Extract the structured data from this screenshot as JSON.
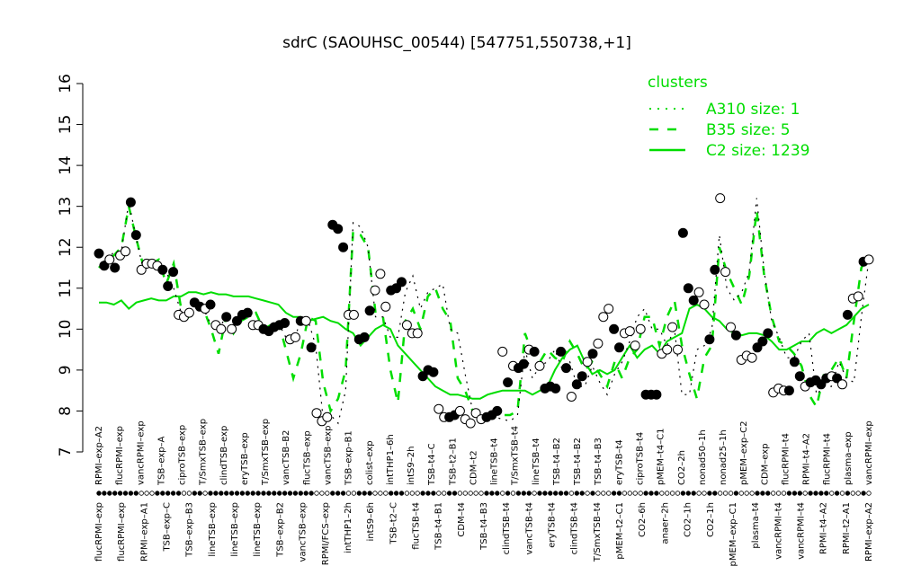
{
  "chart_data": {
    "type": "line",
    "title": "sdrC (SAOUHSC_00544) [547751,550738,+1]",
    "xlabel": "",
    "ylabel": "",
    "ylim": [
      7,
      16
    ],
    "yticks": [
      7,
      8,
      9,
      10,
      11,
      12,
      13,
      14,
      15,
      16
    ],
    "grid": false,
    "legend": {
      "title": "clusters",
      "placement": "top-right",
      "color": "#00dd00",
      "entries": [
        {
          "label": "A310 size: 1",
          "style": "dotted"
        },
        {
          "label": "B35 size: 5",
          "style": "dashed"
        },
        {
          "label": "C2 size: 1239",
          "style": "solid"
        }
      ]
    },
    "tick_labels_top": [
      "RPMI–exp–A2",
      "flucRPMI–exp",
      "vancRPMI–exp",
      "TSB–exp–A",
      "ciproTSB–exp",
      "T/SmxTSB–exp",
      "clindTSB–exp",
      "eryTSB–exp",
      "T/SmxTSB–exp",
      "vancTSB–B2",
      "flucTSB–exp",
      "vancTSB–exp",
      "TSB–exp–B1",
      "colist–exp",
      "intTHP1–6h",
      "intS9–2h",
      "TSB–t4–C",
      "TSB–t2–B1",
      "CDM–t2",
      "lineTSB–t4",
      "T/SmxTSB–t4",
      "lineTSB–t4",
      "TSB–t4–B2",
      "TSB–t4–B2",
      "TSB–t4–B3",
      "eryTSB–t4",
      "ciproTSB–t4",
      "pMEM–t4–C1",
      "CO2–2h",
      "nonad50–1h",
      "nonad25–1h",
      "pMEM–exp–C2",
      "CDM–exp",
      "flucRPMI–t4",
      "RPMI–t4–A2",
      "flucRPMI–t4",
      "plasma–exp",
      "vancRPMI–exp"
    ],
    "tick_labels_bottom": [
      "flucRPMI–exp",
      "flucRPMI–exp",
      "RPMI–exp–A1",
      "TSB–exp–C",
      "TSB–exp–B3",
      "lineTSB–exp",
      "lineTSB–exp",
      "lineTSB–exp",
      "TSB–exp–B2",
      "vancTSB–exp",
      "RPMI/FCS–exp",
      "intTHP1–2h",
      "intS9–6h",
      "TSB–t2–C",
      "flucTSB–t4",
      "TSB–t4–B1",
      "CDM–t4",
      "TSB–t4–B3",
      "clindTSB–t4",
      "vancTSB–t4",
      "eryTSB–t4",
      "clindTSB–t4",
      "T/SmxTSB–t4",
      "pMEM–t2–C1",
      "CO2–6h",
      "anaer–2h",
      "CO2–1h",
      "CO2–1h",
      "pMEM–exp–C1",
      "plasma–t4",
      "vancRPMI–t4",
      "vancRPMI–t4",
      "RPMI–t4–A2",
      "RPMI–t2–A1",
      "RPMI–exp–A2"
    ],
    "series": [
      {
        "style": "solid",
        "color": "#00dd00",
        "y": [
          10.65,
          10.65,
          10.6,
          10.7,
          10.5,
          10.65,
          10.7,
          10.75,
          10.7,
          10.7,
          10.8,
          10.8,
          10.9,
          10.9,
          10.85,
          10.9,
          10.85,
          10.85,
          10.8,
          10.8,
          10.8,
          10.75,
          10.7,
          10.65,
          10.6,
          10.4,
          10.3,
          10.3,
          10.2,
          10.25,
          10.3,
          10.2,
          10.15,
          10.0,
          9.9,
          9.6,
          9.8,
          10.0,
          10.1,
          10.0,
          9.6,
          9.4,
          9.2,
          9.0,
          8.8,
          8.6,
          8.5,
          8.4,
          8.4,
          8.35,
          8.3,
          8.3,
          8.4,
          8.45,
          8.5,
          8.5,
          8.5,
          8.5,
          8.4,
          8.5,
          8.6,
          9.0,
          9.3,
          9.5,
          9.6,
          9.2,
          8.9,
          9.0,
          8.9,
          9.0,
          9.3,
          9.6,
          9.3,
          9.5,
          9.6,
          9.4,
          9.7,
          9.8,
          9.9,
          10.5,
          10.6,
          10.5,
          10.3,
          10.2,
          10.0,
          9.9,
          9.85,
          9.9,
          9.9,
          9.85,
          9.7,
          9.5,
          9.5,
          9.6,
          9.7,
          9.7,
          9.9,
          10.0,
          9.9,
          10.0,
          10.1,
          10.3,
          10.5,
          10.6
        ]
      },
      {
        "style": "dashed",
        "color": "#00dd00",
        "y": [
          11.5,
          11.7,
          11.8,
          12.0,
          13.0,
          12.2,
          11.5,
          11.6,
          11.7,
          11.1,
          11.6,
          10.5,
          10.3,
          10.6,
          10.5,
          10.0,
          9.4,
          10.3,
          9.9,
          10.2,
          10.3,
          10.4,
          10.0,
          10.1,
          10.2,
          9.5,
          8.8,
          9.4,
          10.3,
          10.2,
          8.7,
          8.0,
          8.3,
          9.0,
          12.4,
          12.3,
          12.0,
          10.4,
          10.3,
          9.0,
          8.2,
          10.2,
          10.5,
          10.0,
          10.8,
          11.0,
          10.5,
          10.2,
          8.8,
          8.5,
          8.0,
          7.95,
          7.85,
          7.85,
          7.9,
          7.9,
          8.0,
          9.9,
          9.4,
          9.2,
          9.5,
          9.3,
          9.2,
          9.7,
          9.4,
          9.0,
          9.2,
          8.9,
          8.6,
          9.2,
          8.8,
          9.3,
          9.5,
          10.3,
          10.3,
          9.6,
          10.3,
          10.7,
          9.6,
          8.9,
          8.3,
          9.3,
          9.6,
          12.0,
          11.4,
          11.0,
          10.6,
          11.3,
          12.9,
          11.3,
          10.3,
          9.7,
          9.6,
          9.4,
          9.1,
          8.4,
          8.1,
          8.9,
          9.0,
          9.3,
          8.8,
          10.2,
          11.5,
          11.8
        ]
      },
      {
        "style": "dotted",
        "color": "#00dd00",
        "y": [
          11.8,
          11.6,
          11.9,
          11.9,
          13.1,
          12.2,
          11.4,
          11.6,
          11.6,
          11.4,
          11.0,
          10.4,
          10.4,
          10.6,
          10.5,
          10.1,
          10.0,
          10.3,
          10.2,
          10.3,
          10.4,
          10.1,
          10.0,
          10.1,
          10.15,
          9.8,
          9.7,
          10.2,
          10.2,
          9.6,
          7.8,
          7.9,
          7.7,
          8.5,
          12.6,
          12.5,
          12.0,
          10.3,
          10.3,
          9.8,
          9.8,
          10.9,
          11.3,
          10.5,
          10.9,
          11.0,
          11.1,
          10.0,
          9.9,
          8.9,
          8.0,
          7.9,
          7.85,
          7.85,
          7.8,
          7.75,
          7.9,
          9.5,
          8.8,
          9.1,
          9.2,
          9.5,
          9.0,
          9.2,
          8.6,
          8.6,
          9.1,
          8.7,
          8.4,
          8.9,
          9.2,
          9.7,
          10.3,
          10.5,
          10.0,
          10.0,
          9.6,
          10.0,
          8.4,
          8.4,
          9.5,
          9.6,
          10.0,
          12.3,
          11.0,
          10.7,
          10.9,
          11.4,
          13.2,
          11.4,
          10.2,
          9.8,
          9.3,
          9.3,
          9.7,
          9.9,
          8.4,
          8.6,
          8.6,
          9.2,
          8.8,
          8.7,
          10.3,
          11.7
        ]
      }
    ],
    "points": [
      {
        "y": 11.85,
        "f": 1
      },
      {
        "y": 11.55,
        "f": 1
      },
      {
        "y": 11.7,
        "f": 0
      },
      {
        "y": 11.5,
        "f": 1
      },
      {
        "y": 11.8,
        "f": 0
      },
      {
        "y": 11.9,
        "f": 0
      },
      {
        "y": 13.1,
        "f": 1
      },
      {
        "y": 12.3,
        "f": 1
      },
      {
        "y": 11.45,
        "f": 0
      },
      {
        "y": 11.6,
        "f": 0
      },
      {
        "y": 11.6,
        "f": 0
      },
      {
        "y": 11.55,
        "f": 0
      },
      {
        "y": 11.45,
        "f": 1
      },
      {
        "y": 11.05,
        "f": 1
      },
      {
        "y": 11.4,
        "f": 1
      },
      {
        "y": 10.35,
        "f": 0
      },
      {
        "y": 10.3,
        "f": 0
      },
      {
        "y": 10.4,
        "f": 0
      },
      {
        "y": 10.65,
        "f": 1
      },
      {
        "y": 10.55,
        "f": 1
      },
      {
        "y": 10.5,
        "f": 0
      },
      {
        "y": 10.6,
        "f": 1
      },
      {
        "y": 10.1,
        "f": 0
      },
      {
        "y": 10.0,
        "f": 0
      },
      {
        "y": 10.3,
        "f": 1
      },
      {
        "y": 10.0,
        "f": 0
      },
      {
        "y": 10.2,
        "f": 1
      },
      {
        "y": 10.35,
        "f": 1
      },
      {
        "y": 10.4,
        "f": 1
      },
      {
        "y": 10.1,
        "f": 0
      },
      {
        "y": 10.1,
        "f": 0
      },
      {
        "y": 10.0,
        "f": 1
      },
      {
        "y": 9.95,
        "f": 1
      },
      {
        "y": 10.05,
        "f": 1
      },
      {
        "y": 10.1,
        "f": 1
      },
      {
        "y": 10.15,
        "f": 1
      },
      {
        "y": 9.75,
        "f": 0
      },
      {
        "y": 9.8,
        "f": 0
      },
      {
        "y": 10.2,
        "f": 1
      },
      {
        "y": 10.2,
        "f": 0
      },
      {
        "y": 9.55,
        "f": 1
      },
      {
        "y": 7.95,
        "f": 0
      },
      {
        "y": 7.75,
        "f": 0
      },
      {
        "y": 7.85,
        "f": 0
      },
      {
        "y": 12.55,
        "f": 1
      },
      {
        "y": 12.45,
        "f": 1
      },
      {
        "y": 12.0,
        "f": 1
      },
      {
        "y": 10.35,
        "f": 0
      },
      {
        "y": 10.35,
        "f": 0
      },
      {
        "y": 9.75,
        "f": 1
      },
      {
        "y": 9.8,
        "f": 1
      },
      {
        "y": 10.45,
        "f": 1
      },
      {
        "y": 10.95,
        "f": 0
      },
      {
        "y": 11.35,
        "f": 0
      },
      {
        "y": 10.55,
        "f": 0
      },
      {
        "y": 10.95,
        "f": 1
      },
      {
        "y": 11.0,
        "f": 1
      },
      {
        "y": 11.15,
        "f": 1
      },
      {
        "y": 10.1,
        "f": 0
      },
      {
        "y": 9.9,
        "f": 0
      },
      {
        "y": 9.9,
        "f": 0
      },
      {
        "y": 8.85,
        "f": 1
      },
      {
        "y": 9.0,
        "f": 1
      },
      {
        "y": 8.95,
        "f": 1
      },
      {
        "y": 8.05,
        "f": 0
      },
      {
        "y": 7.85,
        "f": 0
      },
      {
        "y": 7.85,
        "f": 1
      },
      {
        "y": 7.9,
        "f": 1
      },
      {
        "y": 8.0,
        "f": 0
      },
      {
        "y": 7.8,
        "f": 0
      },
      {
        "y": 7.7,
        "f": 0
      },
      {
        "y": 7.95,
        "f": 0
      },
      {
        "y": 7.8,
        "f": 0
      },
      {
        "y": 7.85,
        "f": 1
      },
      {
        "y": 7.9,
        "f": 1
      },
      {
        "y": 8.0,
        "f": 1
      },
      {
        "y": 9.45,
        "f": 0
      },
      {
        "y": 8.7,
        "f": 1
      },
      {
        "y": 9.1,
        "f": 0
      },
      {
        "y": 9.05,
        "f": 1
      },
      {
        "y": 9.15,
        "f": 1
      },
      {
        "y": 9.5,
        "f": 0
      },
      {
        "y": 9.45,
        "f": 1
      },
      {
        "y": 9.1,
        "f": 0
      },
      {
        "y": 8.55,
        "f": 1
      },
      {
        "y": 8.6,
        "f": 1
      },
      {
        "y": 8.55,
        "f": 1
      },
      {
        "y": 9.45,
        "f": 1
      },
      {
        "y": 9.05,
        "f": 1
      },
      {
        "y": 8.35,
        "f": 0
      },
      {
        "y": 8.65,
        "f": 1
      },
      {
        "y": 8.85,
        "f": 1
      },
      {
        "y": 9.2,
        "f": 0
      },
      {
        "y": 9.4,
        "f": 1
      },
      {
        "y": 9.65,
        "f": 0
      },
      {
        "y": 10.3,
        "f": 0
      },
      {
        "y": 10.5,
        "f": 0
      },
      {
        "y": 10.0,
        "f": 1
      },
      {
        "y": 9.55,
        "f": 1
      },
      {
        "y": 9.9,
        "f": 0
      },
      {
        "y": 9.95,
        "f": 0
      },
      {
        "y": 9.6,
        "f": 0
      },
      {
        "y": 10.0,
        "f": 0
      },
      {
        "y": 8.4,
        "f": 1
      },
      {
        "y": 8.4,
        "f": 1
      },
      {
        "y": 8.4,
        "f": 1
      },
      {
        "y": 9.4,
        "f": 0
      },
      {
        "y": 9.5,
        "f": 0
      },
      {
        "y": 10.05,
        "f": 0
      },
      {
        "y": 9.5,
        "f": 0
      },
      {
        "y": 12.35,
        "f": 1
      },
      {
        "y": 11.0,
        "f": 1
      },
      {
        "y": 10.7,
        "f": 1
      },
      {
        "y": 10.9,
        "f": 0
      },
      {
        "y": 10.6,
        "f": 0
      },
      {
        "y": 9.75,
        "f": 1
      },
      {
        "y": 11.45,
        "f": 1
      },
      {
        "y": 13.2,
        "f": 0
      },
      {
        "y": 11.4,
        "f": 0
      },
      {
        "y": 10.05,
        "f": 0
      },
      {
        "y": 9.85,
        "f": 1
      },
      {
        "y": 9.25,
        "f": 0
      },
      {
        "y": 9.35,
        "f": 0
      },
      {
        "y": 9.3,
        "f": 0
      },
      {
        "y": 9.55,
        "f": 1
      },
      {
        "y": 9.7,
        "f": 1
      },
      {
        "y": 9.9,
        "f": 1
      },
      {
        "y": 8.45,
        "f": 0
      },
      {
        "y": 8.55,
        "f": 0
      },
      {
        "y": 8.5,
        "f": 0
      },
      {
        "y": 8.5,
        "f": 1
      },
      {
        "y": 9.2,
        "f": 1
      },
      {
        "y": 8.85,
        "f": 1
      },
      {
        "y": 8.6,
        "f": 0
      },
      {
        "y": 8.7,
        "f": 1
      },
      {
        "y": 8.75,
        "f": 1
      },
      {
        "y": 8.65,
        "f": 1
      },
      {
        "y": 8.8,
        "f": 1
      },
      {
        "y": 8.85,
        "f": 0
      },
      {
        "y": 8.8,
        "f": 1
      },
      {
        "y": 8.65,
        "f": 0
      },
      {
        "y": 10.35,
        "f": 1
      },
      {
        "y": 10.75,
        "f": 0
      },
      {
        "y": 10.8,
        "f": 0
      },
      {
        "y": 11.65,
        "f": 1
      },
      {
        "y": 11.7,
        "f": 0
      }
    ],
    "rug_filled": [
      1,
      1,
      1,
      1,
      1,
      1,
      1,
      1,
      0,
      0,
      0,
      1,
      1,
      1,
      1,
      1,
      0,
      0,
      1,
      1,
      0,
      1,
      1,
      1,
      1,
      1,
      1,
      1,
      1,
      1,
      1,
      1,
      1,
      1,
      1,
      1,
      1,
      1,
      1,
      1,
      1,
      0,
      0,
      0,
      1,
      1,
      1,
      0,
      0,
      1,
      1,
      1,
      0,
      0,
      0,
      1,
      1,
      1,
      0,
      0,
      0,
      1,
      1,
      1,
      0,
      0,
      1,
      1,
      0,
      0,
      0,
      0,
      0,
      1,
      1,
      1,
      0,
      1,
      0,
      1,
      1,
      1,
      0,
      1,
      1,
      1,
      1,
      1,
      1,
      0,
      1,
      1,
      0,
      1,
      0,
      0,
      0,
      1,
      1,
      0,
      0,
      0,
      0,
      1,
      1,
      1,
      0,
      0,
      0,
      0,
      1,
      1,
      1,
      0,
      0,
      1,
      1,
      0,
      0,
      0,
      1,
      0,
      0,
      0,
      1,
      1,
      1,
      0,
      0,
      0,
      1,
      1,
      1,
      0,
      1,
      1,
      1,
      1,
      0,
      1,
      0,
      1,
      0,
      0,
      1,
      0
    ]
  }
}
